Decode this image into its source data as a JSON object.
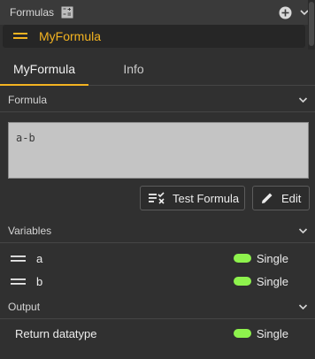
{
  "panel": {
    "title": "Formulas"
  },
  "formula_select": {
    "value": "MyFormula"
  },
  "tabs": [
    {
      "label": "MyFormula",
      "active": true
    },
    {
      "label": "Info",
      "active": false
    }
  ],
  "formula_section": {
    "label": "Formula",
    "text": "a-b",
    "test_button": "Test Formula",
    "edit_button": "Edit"
  },
  "variables_section": {
    "label": "Variables",
    "items": [
      {
        "name": "a",
        "type": "Single"
      },
      {
        "name": "b",
        "type": "Single"
      }
    ]
  },
  "output_section": {
    "label": "Output",
    "return_label": "Return datatype",
    "return_type": "Single"
  },
  "colors": {
    "accent": "#f3b321",
    "type_pill": "#8ef24d",
    "background": "#303030"
  }
}
